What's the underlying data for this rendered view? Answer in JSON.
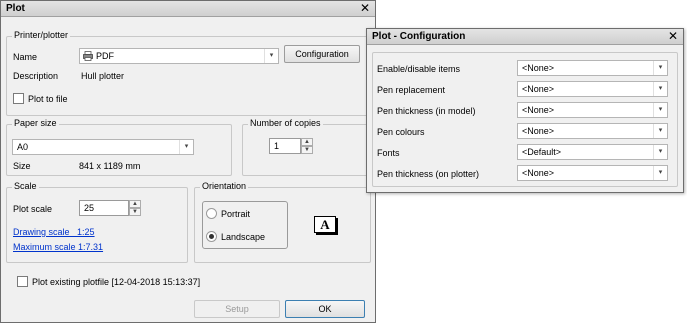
{
  "plot_dialog": {
    "title": "Plot",
    "printer_group": "Printer/plotter",
    "name_label": "Name",
    "printer_value": "PDF",
    "configuration_button": "Configuration",
    "description_label": "Description",
    "description_value": "Hull plotter",
    "plot_to_file_label": "Plot to file",
    "paper_size_group": "Paper size",
    "paper_size_value": "A0",
    "size_label": "Size",
    "size_value": "841 x 1189 mm",
    "copies_group": "Number of copies",
    "copies_value": "1",
    "scale_group": "Scale",
    "plot_scale_label": "Plot scale",
    "plot_scale_value": "25",
    "drawing_scale_link": "Drawing scale   1:25",
    "maximum_scale_link": "Maximum scale 1:7.31",
    "orientation_group": "Orientation",
    "portrait_label": "Portrait",
    "landscape_label": "Landscape",
    "orientation_glyph": "A",
    "plot_existing_label": "Plot existing plotfile [12-04-2018 15:13:37]",
    "setup_button": "Setup",
    "ok_button": "OK"
  },
  "config_dialog": {
    "title": "Plot - Configuration",
    "rows": [
      {
        "label": "Enable/disable items",
        "value": "<None>"
      },
      {
        "label": "Pen replacement",
        "value": "<None>"
      },
      {
        "label": "Pen thickness (in model)",
        "value": "<None>"
      },
      {
        "label": "Pen colours",
        "value": "<None>"
      },
      {
        "label": "Fonts",
        "value": "<Default>"
      },
      {
        "label": "Pen thickness (on plotter)",
        "value": "<None>"
      }
    ]
  },
  "icons": {
    "close": "✕",
    "dropdown": "▾",
    "spin_up": "▲",
    "spin_down": "▼"
  },
  "colors": {
    "link": "#0033cc",
    "window_bg": "#f0f0f0"
  }
}
